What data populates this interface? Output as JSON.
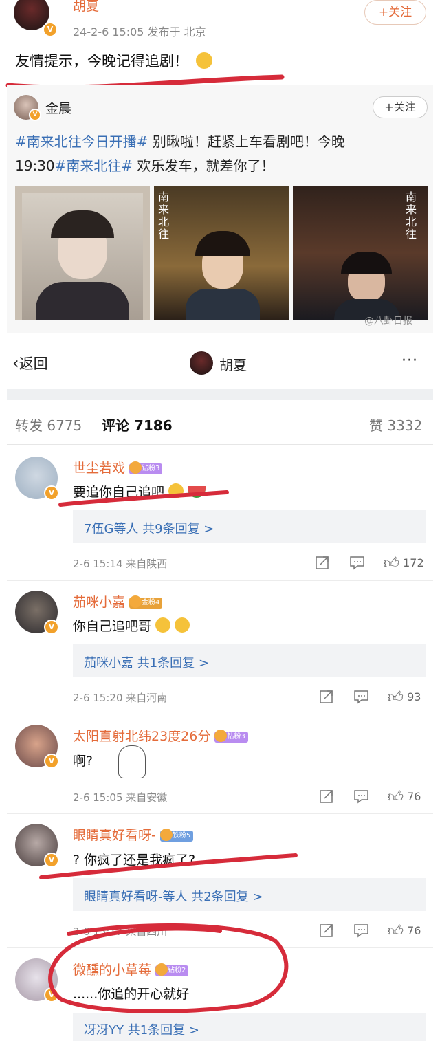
{
  "top_post": {
    "author": "胡夏",
    "follow_label": "+关注",
    "meta": "24-2-6 15:05 发布于 北京",
    "text": "友情提示，今晚记得追剧！"
  },
  "quoted_post": {
    "author": "金晨",
    "follow_label": "+关注",
    "topic1": "#南来北往今日开播#",
    "text1": " 别瞅啦！赶紧上车看剧吧！今晚",
    "text2a": "19:30",
    "topic2": "#南来北往#",
    "text2b": " 欢乐发车，就差你了！",
    "image_caption": "南来北往",
    "watermark": "@八卦日报"
  },
  "nav": {
    "back_label": "返回",
    "title": "胡夏",
    "more": "···"
  },
  "tabs": {
    "repost_label": "转发",
    "repost_count": "6775",
    "comment_label": "评论",
    "comment_count": "7186",
    "like_label": "赞",
    "like_count": "3332"
  },
  "comments": [
    {
      "name": "世尘若戏",
      "badge": "钻粉3",
      "text": "要追你自己追吧",
      "reply_text": "7伍G等人  共9条回复 >",
      "time": "2-6 15:14  来自陕西",
      "likes": "172"
    },
    {
      "name": "茄咪小嘉",
      "badge": "金粉4",
      "text": "你自己追吧哥",
      "reply_text": "茄咪小嘉  共1条回复 >",
      "time": "2-6 15:20  来自河南",
      "likes": "93"
    },
    {
      "name": "太阳直射北纬23度26分",
      "badge": "钻粉3",
      "text": "啊?",
      "time": "2-6 15:05  来自安徽",
      "likes": "76"
    },
    {
      "name": "眼睛真好看呀-",
      "badge": "铁粉5",
      "text": "?  你疯了还是我疯了?",
      "reply_text": "眼睛真好看呀-等人  共2条回复 >",
      "time": "2-6 15:17  来自四川",
      "likes": "76"
    },
    {
      "name": "微醺的小草莓",
      "badge": "钻粉2",
      "text": "......你追的开心就好",
      "reply_text": "冴冴YY  共1条回复 >"
    }
  ],
  "colors": {
    "accent": "#e46b3a",
    "link": "#3a6fb5",
    "annotation": "#d62b3a",
    "badge": "#b98cf0"
  }
}
